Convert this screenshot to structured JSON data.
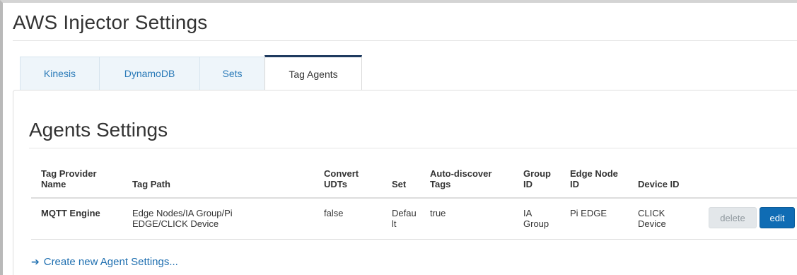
{
  "page": {
    "title": "AWS Injector Settings"
  },
  "tabs": [
    {
      "label": "Kinesis",
      "active": false
    },
    {
      "label": "DynamoDB",
      "active": false
    },
    {
      "label": "Sets",
      "active": false
    },
    {
      "label": "Tag Agents",
      "active": true
    }
  ],
  "section": {
    "title": "Agents Settings"
  },
  "table": {
    "headers": {
      "provider_1": "Tag Provider",
      "provider_2": "Name",
      "path": "Tag Path",
      "convert_1": "Convert",
      "convert_2": "UDTs",
      "set": "Set",
      "auto_1": "Auto-discover",
      "auto_2": "Tags",
      "group_1": "Group",
      "group_2": "ID",
      "edge_1": "Edge Node",
      "edge_2": "ID",
      "device": "Device ID"
    },
    "rows": [
      {
        "provider": "MQTT Engine",
        "path_1": "Edge Nodes/IA Group/Pi",
        "path_2": "EDGE/CLICK Device",
        "convert": "false",
        "set_1": "Defau",
        "set_2": "lt",
        "auto": "true",
        "group_1": "IA",
        "group_2": "Group",
        "edge": "Pi EDGE",
        "device_1": "CLICK",
        "device_2": "Device",
        "delete_label": "delete",
        "edit_label": "edit"
      }
    ]
  },
  "actions": {
    "create_label": "Create new Agent Settings..."
  },
  "colors": {
    "accent": "#0f6cb4",
    "link": "#1f6fb0",
    "active_tab_border": "#1e3a5f"
  }
}
